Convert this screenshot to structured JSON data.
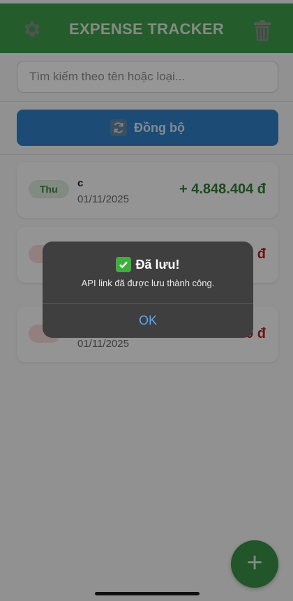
{
  "header": {
    "title": "EXPENSE TRACKER",
    "settings_icon": "gear-icon",
    "trash_icon": "trash-icon",
    "color": "#3d9a49"
  },
  "search": {
    "placeholder": "Tìm kiếm theo tên hoặc loại..."
  },
  "sync": {
    "label": "Đồng bộ",
    "icon": "sync-icon",
    "color": "#2f7fc4"
  },
  "transactions": [
    {
      "type": "Thu",
      "kind": "income",
      "name": "c",
      "date": "01/11/2025",
      "amount": "+ 4.848.404 đ"
    },
    {
      "type": "",
      "kind": "expense",
      "name": "",
      "date": "",
      "amount": "đ"
    },
    {
      "type": "",
      "kind": "expense",
      "name": "",
      "date": "01/11/2025",
      "amount": "-10.000 đ"
    }
  ],
  "fab": {
    "label": "+",
    "icon": "plus-icon"
  },
  "alert": {
    "title": "Đã lưu!",
    "title_icon": "check-mark-icon",
    "message": "API link đã được lưu thành công.",
    "ok_label": "OK"
  },
  "colors": {
    "income": "#2f7d34",
    "expense": "#b02424",
    "alert_button": "#5aa8ff"
  }
}
